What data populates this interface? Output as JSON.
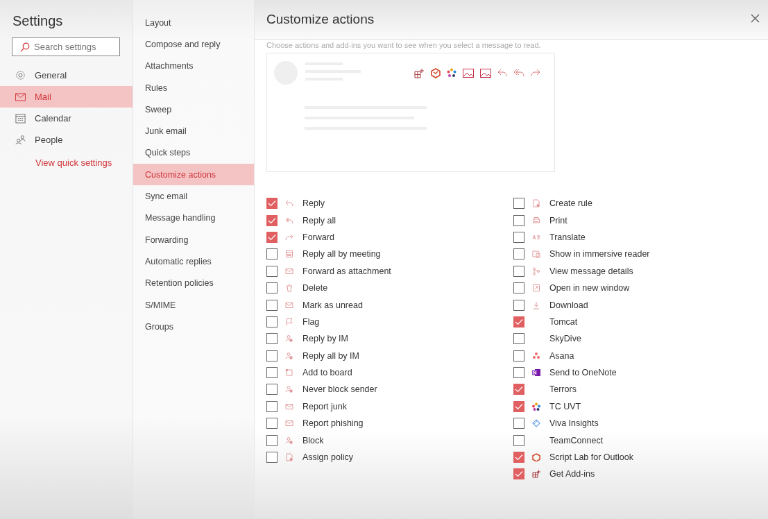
{
  "sidebar": {
    "title": "Settings",
    "search": {
      "placeholder": "Search settings"
    },
    "items": [
      {
        "label": "General",
        "selected": false
      },
      {
        "label": "Mail",
        "selected": true
      },
      {
        "label": "Calendar",
        "selected": false
      },
      {
        "label": "People",
        "selected": false
      }
    ],
    "link": "View quick settings"
  },
  "subnav": {
    "items": [
      {
        "label": "Layout",
        "selected": false
      },
      {
        "label": "Compose and reply",
        "selected": false
      },
      {
        "label": "Attachments",
        "selected": false
      },
      {
        "label": "Rules",
        "selected": false
      },
      {
        "label": "Sweep",
        "selected": false
      },
      {
        "label": "Junk email",
        "selected": false
      },
      {
        "label": "Quick steps",
        "selected": false
      },
      {
        "label": "Customize actions",
        "selected": true
      },
      {
        "label": "Sync email",
        "selected": false
      },
      {
        "label": "Message handling",
        "selected": false
      },
      {
        "label": "Forwarding",
        "selected": false
      },
      {
        "label": "Automatic replies",
        "selected": false
      },
      {
        "label": "Retention policies",
        "selected": false
      },
      {
        "label": "S/MIME",
        "selected": false
      },
      {
        "label": "Groups",
        "selected": false
      }
    ]
  },
  "panel": {
    "title": "Customize actions",
    "subtitle": "Choose actions and add-ins you want to see when you select a message to read.",
    "columns": [
      [
        {
          "label": "Reply",
          "checked": true,
          "icon": true
        },
        {
          "label": "Reply all",
          "checked": true,
          "icon": true
        },
        {
          "label": "Forward",
          "checked": true,
          "icon": true
        },
        {
          "label": "Reply all by meeting",
          "checked": false,
          "icon": true
        },
        {
          "label": "Forward as attachment",
          "checked": false,
          "icon": true
        },
        {
          "label": "Delete",
          "checked": false,
          "icon": true
        },
        {
          "label": "Mark as unread",
          "checked": false,
          "icon": true
        },
        {
          "label": "Flag",
          "checked": false,
          "icon": true
        },
        {
          "label": "Reply by IM",
          "checked": false,
          "icon": true
        },
        {
          "label": "Reply all by IM",
          "checked": false,
          "icon": true
        },
        {
          "label": "Add to board",
          "checked": false,
          "icon": true
        },
        {
          "label": "Never block sender",
          "checked": false,
          "icon": true
        },
        {
          "label": "Report junk",
          "checked": false,
          "icon": true
        },
        {
          "label": "Report phishing",
          "checked": false,
          "icon": true
        },
        {
          "label": "Block",
          "checked": false,
          "icon": true
        },
        {
          "label": "Assign policy",
          "checked": false,
          "icon": true
        }
      ],
      [
        {
          "label": "Create rule",
          "checked": false,
          "icon": true
        },
        {
          "label": "Print",
          "checked": false,
          "icon": true
        },
        {
          "label": "Translate",
          "checked": false,
          "icon": true
        },
        {
          "label": "Show in immersive reader",
          "checked": false,
          "icon": true
        },
        {
          "label": "View message details",
          "checked": false,
          "icon": true
        },
        {
          "label": "Open in new window",
          "checked": false,
          "icon": true
        },
        {
          "label": "Download",
          "checked": false,
          "icon": true
        },
        {
          "label": "Tomcat",
          "checked": true,
          "icon": false
        },
        {
          "label": "SkyDive",
          "checked": false,
          "icon": false
        },
        {
          "label": "Asana",
          "checked": false,
          "icon": true
        },
        {
          "label": "Send to OneNote",
          "checked": false,
          "icon": true
        },
        {
          "label": "Terrors",
          "checked": true,
          "icon": false
        },
        {
          "label": "TC UVT",
          "checked": true,
          "icon": true
        },
        {
          "label": "Viva Insights",
          "checked": false,
          "icon": true
        },
        {
          "label": "TeamConnect",
          "checked": false,
          "icon": false
        },
        {
          "label": "Script Lab for Outlook",
          "checked": true,
          "icon": true
        },
        {
          "label": "Get Add-ins",
          "checked": true,
          "icon": true
        }
      ]
    ]
  }
}
